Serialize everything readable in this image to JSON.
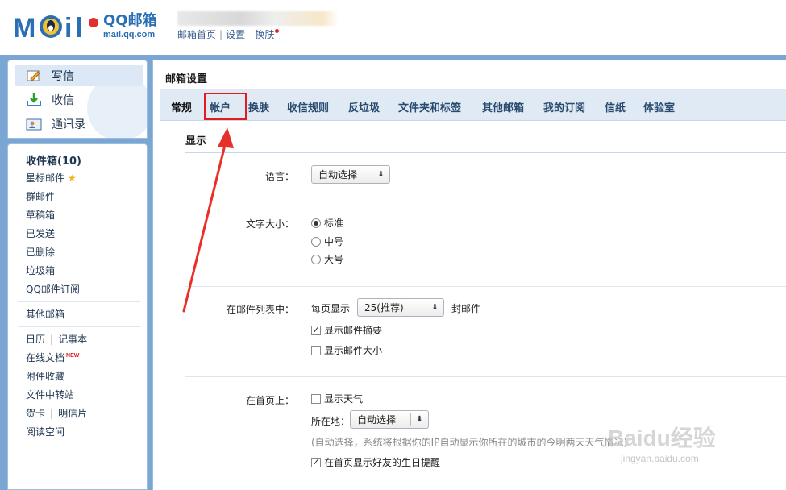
{
  "header": {
    "logo_title": "QQ邮箱",
    "logo_url": "mail.qq.com",
    "links": [
      "邮箱首页",
      "设置",
      "换肤"
    ]
  },
  "quick": {
    "write": "写信",
    "inbox": "收信",
    "contacts": "通讯录"
  },
  "folders": {
    "inbox": "收件箱(10)",
    "starred": "星标邮件",
    "group": "群邮件",
    "drafts": "草稿箱",
    "sent": "已发送",
    "deleted": "已删除",
    "spam": "垃圾箱",
    "subscribe": "QQ邮件订阅",
    "other": "其他邮箱",
    "calendar": "日历",
    "notes": "记事本",
    "docs": "在线文档",
    "docs_badge": "NEW",
    "attachments": "附件收藏",
    "transfer": "文件中转站",
    "cards": "贺卡",
    "postcards": "明信片",
    "reading": "阅读空间"
  },
  "main": {
    "title": "邮箱设置",
    "tabs": [
      "常规",
      "帐户",
      "换肤",
      "收信规则",
      "反垃圾",
      "文件夹和标签",
      "其他邮箱",
      "我的订阅",
      "信纸",
      "体验室"
    ],
    "active_tab": "常规",
    "highlighted_tab": "帐户",
    "section": "显示"
  },
  "settings": {
    "language": {
      "label": "语言：",
      "value": "自动选择"
    },
    "font_size": {
      "label": "文字大小：",
      "options": [
        "标准",
        "中号",
        "大号"
      ],
      "selected": "标准"
    },
    "list": {
      "label": "在邮件列表中：",
      "per_page_prefix": "每页显示",
      "per_page_value": "25(推荐)",
      "per_page_suffix": "封邮件",
      "show_summary": {
        "label": "显示邮件摘要",
        "checked": true
      },
      "show_size": {
        "label": "显示邮件大小",
        "checked": false
      }
    },
    "homepage": {
      "label": "在首页上：",
      "show_weather": {
        "label": "显示天气",
        "checked": false
      },
      "location_label": "所在地：",
      "location_value": "自动选择",
      "hint": "(自动选择，系统将根据你的IP自动显示你所在的城市的今明两天天气情况)",
      "birthday": {
        "label": "在首页显示好友的生日提醒",
        "checked": true
      }
    }
  },
  "watermark": {
    "text": "Baidu经验",
    "url": "jingyan.baidu.com"
  },
  "colors": {
    "frame": "#7aa6d4",
    "tabbar": "#dfeaf5",
    "highlight": "#e21c1c",
    "arrow": "#e8302a",
    "link": "#3a5f8c",
    "logo": "#2a6fb6"
  }
}
